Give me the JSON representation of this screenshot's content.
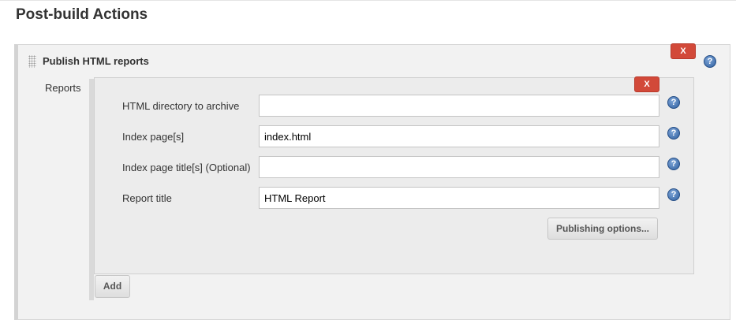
{
  "page": {
    "title": "Post-build Actions"
  },
  "step": {
    "title": "Publish HTML reports",
    "delete_label": "X",
    "help_glyph": "?"
  },
  "reports": {
    "label": "Reports",
    "delete_label": "X",
    "fields": [
      {
        "label": "HTML directory to archive",
        "value": "",
        "help_glyph": "?"
      },
      {
        "label": "Index page[s]",
        "value": "index.html",
        "help_glyph": "?"
      },
      {
        "label": "Index page title[s] (Optional)",
        "value": "",
        "help_glyph": "?"
      },
      {
        "label": "Report title",
        "value": "HTML Report",
        "help_glyph": "?"
      }
    ],
    "publishing_options_label": "Publishing options...",
    "add_label": "Add"
  },
  "icons": {
    "help": "help-icon",
    "drag": "drag-handle-icon",
    "delete": "delete-icon"
  },
  "colors": {
    "delete_button": "#d24939",
    "help_icon": "#2f5f9f"
  }
}
